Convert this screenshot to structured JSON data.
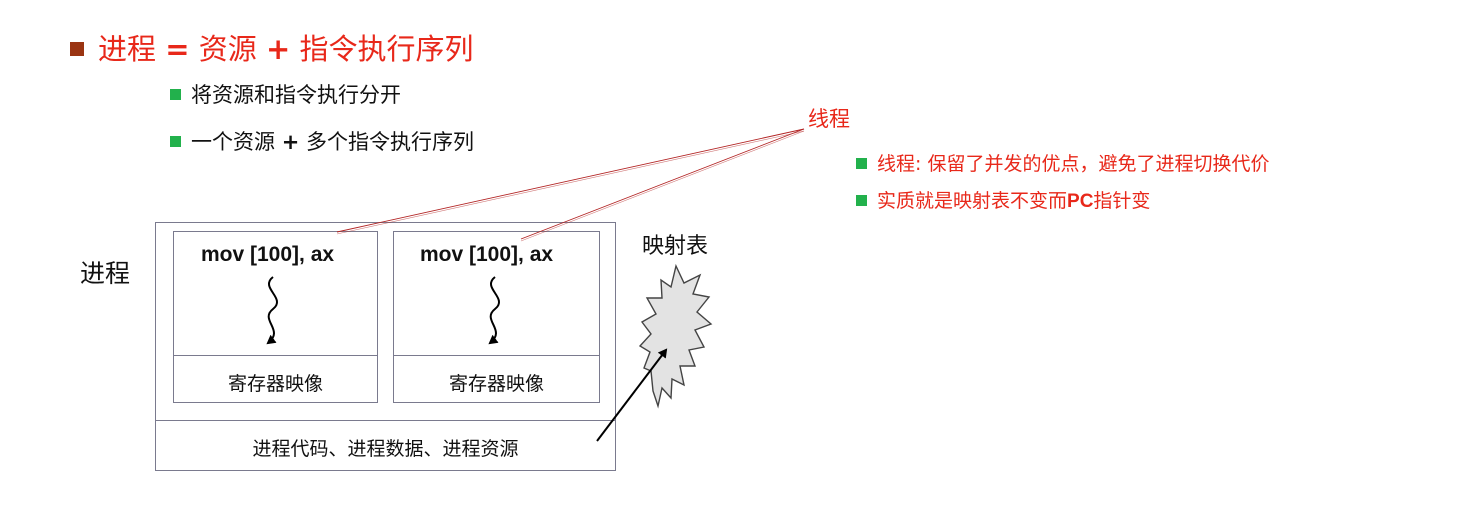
{
  "heading": {
    "prefix": "进程 ",
    "eq": "=",
    "mid": " 资源 ",
    "plus": "+",
    "suffix": " 指令执行序列"
  },
  "bullets": [
    {
      "text": "将资源和指令执行分开"
    },
    {
      "pre": "一个资源 ",
      "plus": "+",
      "post": " 多个指令执行序列"
    }
  ],
  "thread_label": "线程",
  "notes": [
    {
      "text": "线程: 保留了并发的优点，避免了进程切换代价"
    },
    {
      "pre": "实质就是映射表不变而",
      "bold": "PC",
      "post": "指针变"
    }
  ],
  "diagram": {
    "process_label": "进程",
    "map_label": "映射表",
    "threads": [
      {
        "code": "mov [100], ax",
        "register": "寄存器映像"
      },
      {
        "code": "mov [100], ax",
        "register": "寄存器映像"
      }
    ],
    "shared": "进程代码、进程数据、进程资源"
  },
  "colors": {
    "accent_red": "#e8281a",
    "bullet_green": "#22b14c",
    "bullet_brown": "#9a3412",
    "box_border": "#7a7a8e"
  }
}
